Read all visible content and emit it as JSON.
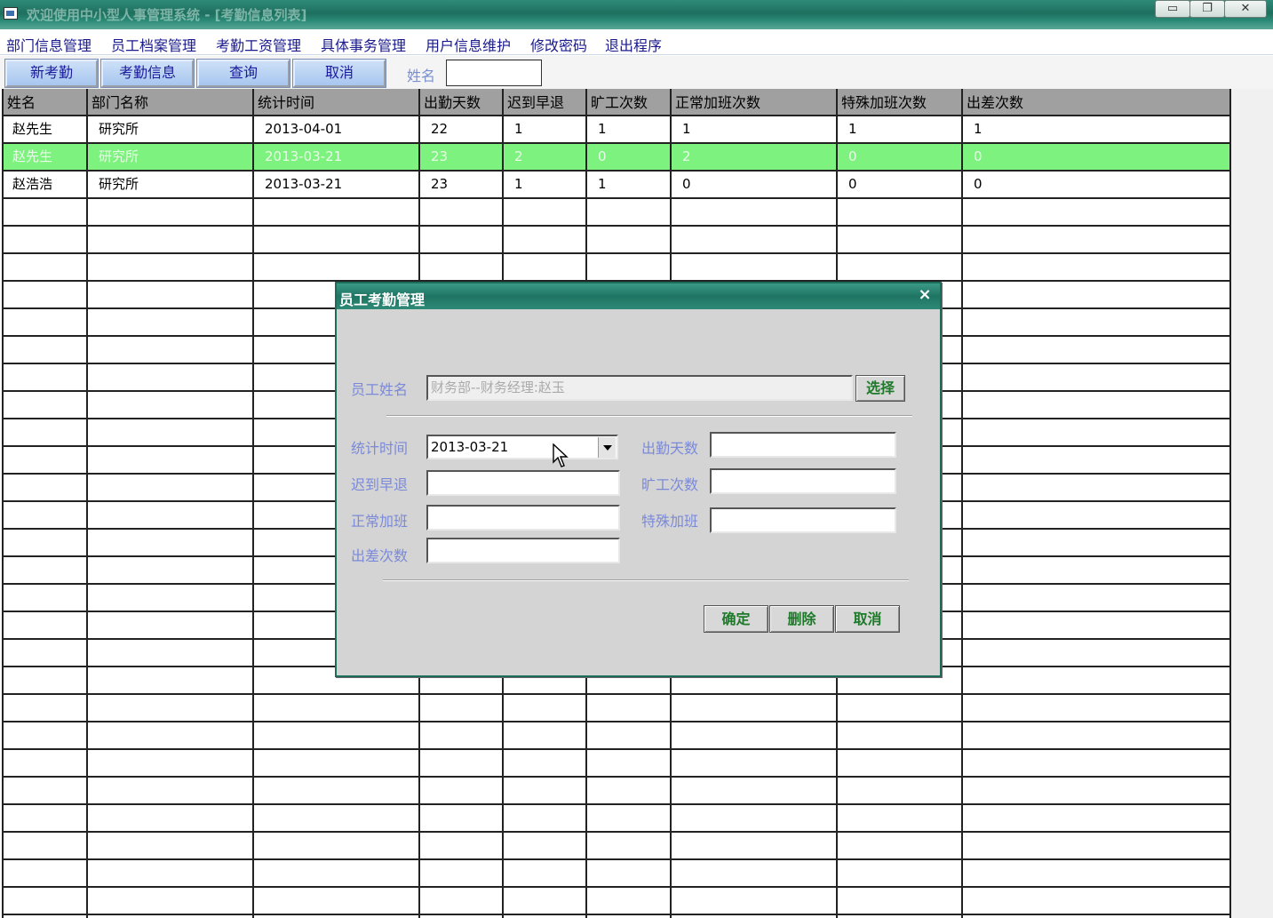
{
  "window": {
    "title": "欢迎使用中小型人事管理系统 - [考勤信息列表]",
    "buttons": {
      "minimize": "▭",
      "restore": "❐",
      "close": "✕"
    }
  },
  "menu": [
    "部门信息管理",
    "员工档案管理",
    "考勤工资管理",
    "具体事务管理",
    "用户信息维护",
    "修改密码",
    "退出程序"
  ],
  "toolbar": {
    "buttons": [
      "新考勤",
      "考勤信息",
      "查询",
      "取消"
    ],
    "name_label": "姓名",
    "name_value": ""
  },
  "grid": {
    "columns": [
      "姓名",
      "部门名称",
      "统计时间",
      "出勤天数",
      "迟到早退",
      "旷工次数",
      "正常加班次数",
      "特殊加班次数",
      "出差次数"
    ],
    "rows": [
      [
        "赵先生",
        "研究所",
        "2013-04-01",
        "22",
        "1",
        "1",
        "1",
        "1",
        "1"
      ],
      [
        "赵先生",
        "研究所",
        "2013-03-21",
        "23",
        "2",
        "0",
        "2",
        "0",
        "0"
      ],
      [
        "赵浩浩",
        "研究所",
        "2013-03-21",
        "23",
        "1",
        "1",
        "0",
        "0",
        "0"
      ]
    ],
    "selected_row": 1,
    "selected_color": "#7ef27e"
  },
  "dialog": {
    "title": "员工考勤管理",
    "close": "×",
    "employee_label": "员工姓名",
    "employee_value": "财务部--财务经理:赵玉",
    "select_button": "选择",
    "date_label": "统计时间",
    "date_value": "2013-03-21",
    "attendance_label": "出勤天数",
    "attendance_value": "",
    "late_label": "迟到早退",
    "late_value": "",
    "absent_label": "旷工次数",
    "absent_value": "",
    "normal_ot_label": "正常加班",
    "normal_ot_value": "",
    "special_ot_label": "特殊加班",
    "special_ot_value": "",
    "trip_label": "出差次数",
    "trip_value": "",
    "confirm_button": "确定",
    "delete_button": "删除",
    "cancel_button": "取消"
  }
}
